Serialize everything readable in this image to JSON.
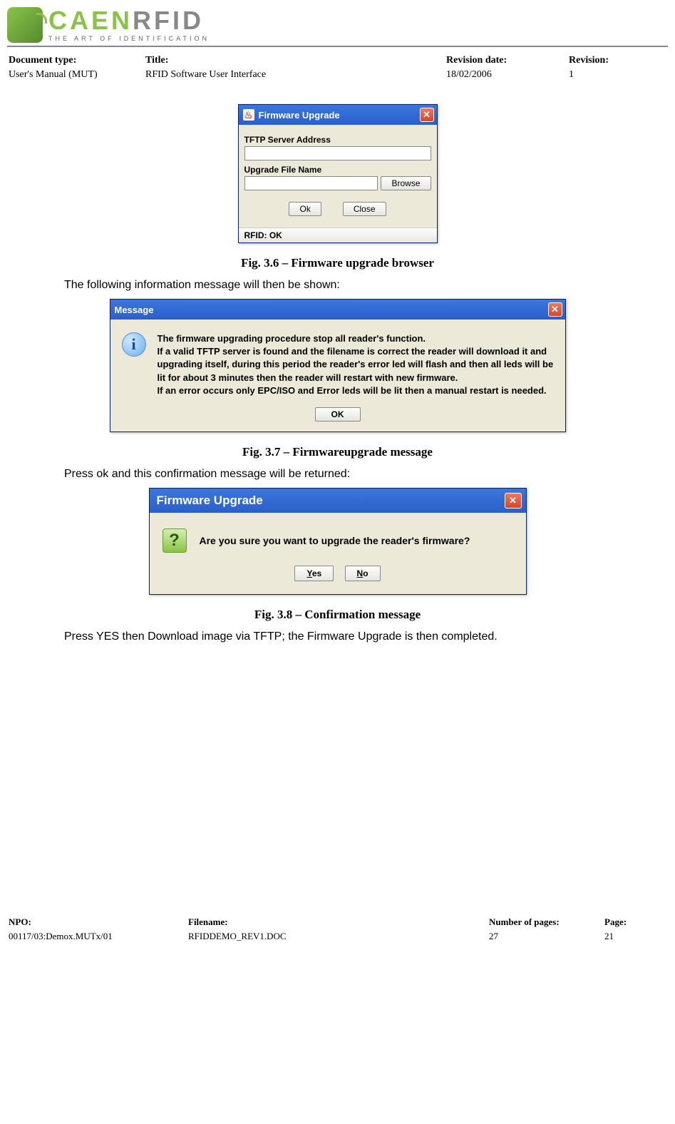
{
  "logo": {
    "main": "CAEN",
    "rfid": "RFID",
    "tagline": "THE ART OF IDENTIFICATION"
  },
  "header": {
    "doc_type_lbl": "Document type:",
    "doc_type_val": "User's Manual (MUT)",
    "title_lbl": "Title:",
    "title_val": "RFID Software User Interface",
    "rev_date_lbl": "Revision date:",
    "rev_date_val": "18/02/2006",
    "rev_lbl": "Revision:",
    "rev_val": "1"
  },
  "dialog1": {
    "title": "Firmware Upgrade",
    "java_icon_char": "♨",
    "tftp_lbl": "TFTP Server Address",
    "upfile_lbl": "Upgrade File Name",
    "browse": "Browse",
    "ok": "Ok",
    "close": "Close",
    "status": "RFID: OK"
  },
  "cap1": "Fig. 3.6 – Firmware upgrade browser",
  "para1": "The following information message will then be shown:",
  "dialog2": {
    "title": "Message",
    "info_char": "i",
    "line1": "The firmware upgrading procedure stop all reader's function.",
    "line2": "If a valid TFTP server is found and the filename is correct the reader will download it and upgrading itself, during this period the reader's error led will flash and then all leds will be lit for about 3 minutes then the reader will restart with new firmware.",
    "line3": "If an error occurs only EPC/ISO and Error leds will be lit then a manual restart is needed.",
    "ok": "OK"
  },
  "cap2": "Fig. 3.7 – Firmwareupgrade message",
  "para2": "Press ok and this confirmation message will be returned:",
  "dialog3": {
    "title": "Firmware Upgrade",
    "q_char": "?",
    "text": "Are you sure you want to upgrade the reader's firmware?",
    "yes": "Yes",
    "no": "No"
  },
  "cap3": "Fig. 3.8 – Confirmation message",
  "para3": "Press YES then Download image via TFTP; the Firmware Upgrade is then completed.",
  "footer": {
    "npo_lbl": "NPO:",
    "npo_val": "00117/03:Demox.MUTx/01",
    "file_lbl": "Filename:",
    "file_val": "RFIDDEMO_REV1.DOC",
    "num_lbl": "Number of pages:",
    "num_val": "27",
    "page_lbl": "Page:",
    "page_val": "21"
  }
}
